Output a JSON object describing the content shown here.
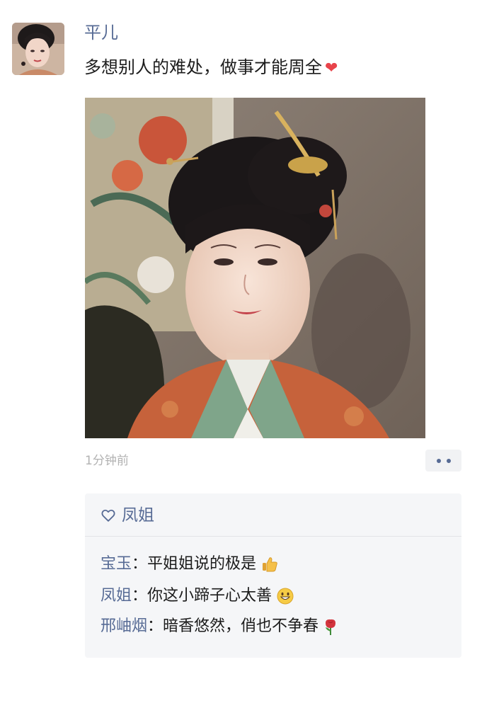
{
  "post": {
    "author": "平儿",
    "text": "多想别人的难处，做事才能周全",
    "text_emoji": "heart-emoji",
    "time": "1分钟前"
  },
  "likes": {
    "icon": "heart-outline-icon",
    "name": "凤姐"
  },
  "comments": [
    {
      "name": "宝玉",
      "sep": "：",
      "text": "平姐姐说的极是",
      "emoji": "thumbs-up-emoji"
    },
    {
      "name": "凤姐",
      "sep": "：",
      "text": "你这小蹄子心太善",
      "emoji": "grinning-face-emoji"
    },
    {
      "name": "邢岫烟",
      "sep": "：",
      "text": "暗香悠然，俏也不争春",
      "emoji": "rose-emoji"
    }
  ],
  "colors": {
    "name_link": "#576b95",
    "time_gray": "#b2b2b2",
    "comment_bg": "#f5f6f8",
    "heart_red": "#e8434a"
  }
}
